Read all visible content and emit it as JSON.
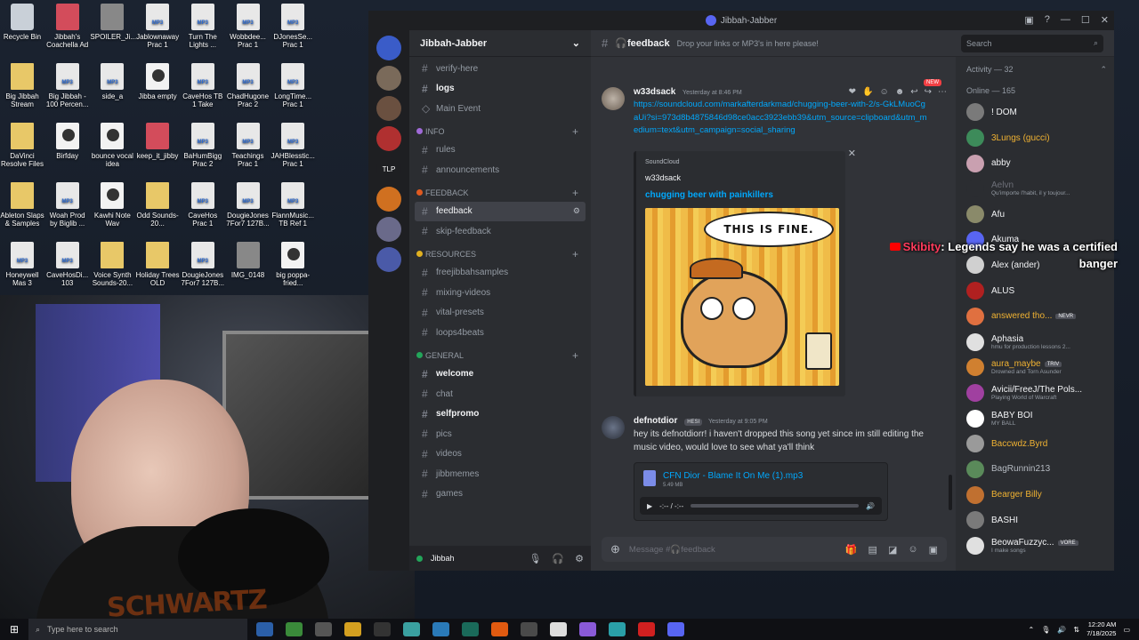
{
  "desktop_icons": [
    {
      "label": "Recycle Bin",
      "kind": "bin"
    },
    {
      "label": "Jibbah's Coachella Ad",
      "kind": "red"
    },
    {
      "label": "SPOILER_Ji...",
      "kind": "img"
    },
    {
      "label": "Jablownaway Prac 1",
      "kind": "mp3"
    },
    {
      "label": "Turn The Lights ...",
      "kind": "mp3"
    },
    {
      "label": "Wobbdee... Prac 1",
      "kind": "mp3"
    },
    {
      "label": "DJonesSe... Prac 1",
      "kind": "mp3"
    },
    {
      "label": "Big Jibbah Stream",
      "kind": "folder"
    },
    {
      "label": "Big Jibbah - 100 Percen...",
      "kind": "mp3"
    },
    {
      "label": "side_a",
      "kind": "mp3"
    },
    {
      "label": "Jibba empty",
      "kind": "video"
    },
    {
      "label": "CaveHos TB 1 Take",
      "kind": "mp3"
    },
    {
      "label": "ChadHugone Prac 2",
      "kind": "mp3"
    },
    {
      "label": "LongTime... Prac 1",
      "kind": "mp3"
    },
    {
      "label": "DaVinci Resolve Files",
      "kind": "folder"
    },
    {
      "label": "Birfday",
      "kind": "video"
    },
    {
      "label": "bounce vocal idea",
      "kind": "video"
    },
    {
      "label": "keep_it_jibby",
      "kind": "red"
    },
    {
      "label": "BaHumBigg Prac 2",
      "kind": "mp3"
    },
    {
      "label": "Teachings Prac 1",
      "kind": "mp3"
    },
    {
      "label": "JAHBlesstic... Prac 1",
      "kind": "mp3"
    },
    {
      "label": "Ableton Slaps & Samples",
      "kind": "folder"
    },
    {
      "label": "Woah Prod by Biglib ...",
      "kind": "mp3"
    },
    {
      "label": "Kawhi Note Wav",
      "kind": "video"
    },
    {
      "label": "Odd Sounds-20...",
      "kind": "folder"
    },
    {
      "label": "CaveHos Prac 1",
      "kind": "mp3"
    },
    {
      "label": "DougieJones 7For7 127B...",
      "kind": "mp3"
    },
    {
      "label": "FlannMusic... TB Ref 1",
      "kind": "mp3"
    },
    {
      "label": "Honeywell Mas 3",
      "kind": "mp3"
    },
    {
      "label": "CaveHosDi... 103",
      "kind": "mp3"
    },
    {
      "label": "Voice Synth Sounds-20...",
      "kind": "folder"
    },
    {
      "label": "Holiday Trees OLD",
      "kind": "folder"
    },
    {
      "label": "DougieJones 7For7 127B...",
      "kind": "mp3"
    },
    {
      "label": "IMG_0148",
      "kind": "img"
    },
    {
      "label": "big poppa-fried...",
      "kind": "video"
    }
  ],
  "webcam": {
    "brand_text": "SCHWARTZ"
  },
  "window": {
    "title": "Jibbah-Jabber"
  },
  "servers": [
    "",
    "",
    "",
    "",
    "TLP",
    "",
    "",
    ""
  ],
  "guild": {
    "name": "Jibbah-Jabber"
  },
  "channels": {
    "top": [
      {
        "label": "verify-here",
        "icon": "#",
        "style": "normal"
      },
      {
        "label": "logs",
        "icon": "#",
        "style": "bold"
      },
      {
        "label": "Main Event",
        "icon": "◇",
        "style": "normal"
      }
    ],
    "cat_info": "INFO",
    "info": [
      {
        "label": "rules",
        "icon": "#"
      },
      {
        "label": "announcements",
        "icon": "#"
      }
    ],
    "cat_feedback": "FEEDBACK",
    "feedback": [
      {
        "label": "feedback",
        "icon": "#"
      },
      {
        "label": "skip-feedback",
        "icon": "#"
      }
    ],
    "cat_resources": "RESOURCES",
    "resources": [
      {
        "label": "freejibbahsamples",
        "icon": "#"
      },
      {
        "label": "mixing-videos",
        "icon": "#"
      },
      {
        "label": "vital-presets",
        "icon": "#"
      },
      {
        "label": "loops4beats",
        "icon": "#"
      }
    ],
    "cat_general": "GENERAL",
    "general": [
      {
        "label": "welcome",
        "icon": "#",
        "style": "bold"
      },
      {
        "label": "chat",
        "icon": "#",
        "style": "normal"
      },
      {
        "label": "selfpromo",
        "icon": "#",
        "style": "bold"
      },
      {
        "label": "pics",
        "icon": "#",
        "style": "normal"
      },
      {
        "label": "videos",
        "icon": "#",
        "style": "normal"
      },
      {
        "label": "jibbmemes",
        "icon": "#",
        "style": "normal"
      },
      {
        "label": "games",
        "icon": "#",
        "style": "normal"
      }
    ]
  },
  "userbar": {
    "name": "Jibbah"
  },
  "chat": {
    "channel": "feedback",
    "topic": "Drop your links or MP3's in here please!",
    "search_placeholder": "Search",
    "new_badge": "NEW",
    "message1": {
      "author": "w33dsack",
      "timestamp": "Yesterday at 8:46 PM",
      "link": "https://soundcloud.com/markafterdarkmad/chugging-beer-with-2/s-GkLMuoCgaUi?si=973d8b4875846d98ce0acc3923ebb39&utm_source=clipboard&utm_medium=text&utm_campaign=social_sharing"
    },
    "embed": {
      "provider": "SoundCloud",
      "author": "w33dsack",
      "title": "chugging beer with painkillers",
      "meme_text": "THIS IS FINE."
    },
    "message2": {
      "author": "defnotdior",
      "badge": "HESI",
      "timestamp": "Yesterday at 9:05 PM",
      "text": "hey its defnotdiorr! i haven't dropped this song yet since im still editing the music video, would love to see what ya'll think"
    },
    "audio": {
      "filename": "CFN Dior - Blame It On Me (1).mp3",
      "size": "5.49 MB",
      "time": "-:-- / -:--"
    },
    "composer_placeholder": "Message #🎧feedback"
  },
  "members": {
    "activity_header": "Activity — 32",
    "online_header": "Online — 165",
    "list": [
      {
        "name": "! DOM",
        "status": "",
        "color": "#f2f3f5",
        "tag": "",
        "avatar": "#7a7a7a"
      },
      {
        "name": "3Lungs (gucci)",
        "status": "",
        "color": "#f0b232",
        "tag": "",
        "avatar": "#3d8b5a"
      },
      {
        "name": "abby",
        "status": "",
        "color": "#f2f3f5",
        "tag": "",
        "avatar": "#c9a0b0"
      },
      {
        "name": "Aelvn",
        "status": "Qu'importe l'habit, il y toujour...",
        "color": "#6d6f78",
        "tag": "",
        "avatar": "#2b2d31"
      },
      {
        "name": "Afu",
        "status": "",
        "color": "#f2f3f5",
        "tag": "",
        "avatar": "#8a8a6a"
      },
      {
        "name": "Akuma",
        "status": "",
        "color": "#f2f3f5",
        "tag": "",
        "avatar": "#5865f2"
      },
      {
        "name": "Alex (ander)",
        "status": "",
        "color": "#f2f3f5",
        "tag": "",
        "avatar": "#d0d0d0"
      },
      {
        "name": "ALUS",
        "status": "",
        "color": "#f2f3f5",
        "tag": "",
        "avatar": "#b02020"
      },
      {
        "name": "answered tho...",
        "status": "",
        "color": "#f0b232",
        "tag": "NEVR",
        "avatar": "#e07040"
      },
      {
        "name": "Aphasia",
        "status": "hmu for production lessons 2...",
        "color": "#f2f3f5",
        "tag": "",
        "avatar": "#e0e0e0"
      },
      {
        "name": "aura_maybe",
        "status": "Drowned and Torn Asunder",
        "color": "#f0b232",
        "tag": "TRIV",
        "avatar": "#d08030"
      },
      {
        "name": "Avicii/FreeJ/The Pols...",
        "status": "Playing World of Warcraft",
        "color": "#f2f3f5",
        "tag": "",
        "avatar": "#a040a0"
      },
      {
        "name": "BABY BOI",
        "status": "MY BALL",
        "color": "#f2f3f5",
        "tag": "",
        "avatar": "#ffffff"
      },
      {
        "name": "Baccwdz.Byrd",
        "status": "",
        "color": "#f0b232",
        "tag": "",
        "avatar": "#9a9a9a"
      },
      {
        "name": "BagRunnin213",
        "status": "",
        "color": "#b5bac1",
        "tag": "",
        "avatar": "#5a8a5a"
      },
      {
        "name": "Bearger Billy",
        "status": "",
        "color": "#f0b232",
        "tag": "",
        "avatar": "#c07030"
      },
      {
        "name": "BASHI",
        "status": "",
        "color": "#f2f3f5",
        "tag": "",
        "avatar": "#7a7a7a"
      },
      {
        "name": "BeowaFuzzyc...",
        "status": "I make songs",
        "color": "#f2f3f5",
        "tag": "VORE",
        "avatar": "#e0e0e0"
      }
    ]
  },
  "overlay": {
    "user": "Skibity",
    "message": "Legends say he was a certified banger"
  },
  "taskbar": {
    "search_placeholder": "Type here to search",
    "time": "12:20 AM",
    "date": "7/18/2025"
  }
}
